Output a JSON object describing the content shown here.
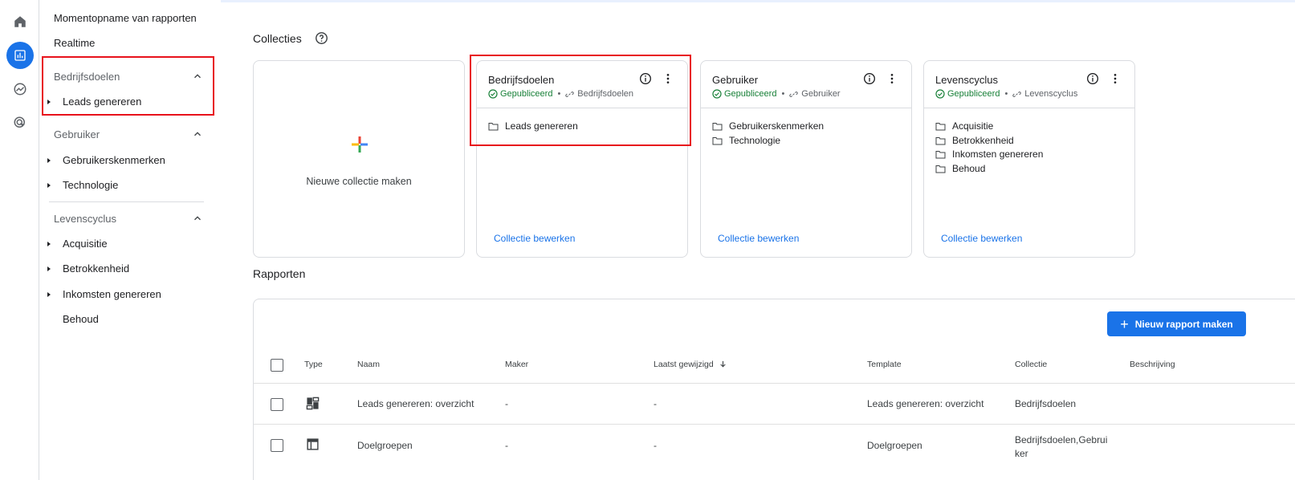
{
  "nav": {
    "snapshot": "Momentopname van rapporten",
    "realtime": "Realtime",
    "sections": [
      {
        "title": "Bedrijfsdoelen",
        "items": [
          "Leads genereren"
        ]
      },
      {
        "title": "Gebruiker",
        "items": [
          "Gebruikerskenmerken",
          "Technologie"
        ]
      },
      {
        "title": "Levenscyclus",
        "items": [
          "Acquisitie",
          "Betrokkenheid",
          "Inkomsten genereren",
          "Behoud"
        ]
      }
    ]
  },
  "collections": {
    "title": "Collecties",
    "new_card_label": "Nieuwe collectie maken",
    "cards": [
      {
        "title": "Bedrijfsdoelen",
        "status": "Gepubliceerd",
        "link": "Bedrijfsdoelen",
        "folders": [
          "Leads genereren"
        ],
        "edit": "Collectie bewerken"
      },
      {
        "title": "Gebruiker",
        "status": "Gepubliceerd",
        "link": "Gebruiker",
        "folders": [
          "Gebruikerskenmerken",
          "Technologie"
        ],
        "edit": "Collectie bewerken"
      },
      {
        "title": "Levenscyclus",
        "status": "Gepubliceerd",
        "link": "Levenscyclus",
        "folders": [
          "Acquisitie",
          "Betrokkenheid",
          "Inkomsten genereren",
          "Behoud"
        ],
        "edit": "Collectie bewerken"
      }
    ]
  },
  "reports": {
    "title": "Rapporten",
    "new_button": "Nieuw rapport maken",
    "columns": [
      "Type",
      "Naam",
      "Maker",
      "Laatst gewijzigd",
      "Template",
      "Collectie",
      "Beschrijving"
    ],
    "rows": [
      {
        "name": "Leads genereren: overzicht",
        "maker": "-",
        "modified": "-",
        "template": "Leads genereren: overzicht",
        "collection": "Bedrijfsdoelen"
      },
      {
        "name": "Doelgroepen",
        "maker": "-",
        "modified": "-",
        "template": "Doelgroepen",
        "collection_line1": "Bedrijfsdoelen,Gebrui",
        "collection_line2": "ker"
      }
    ]
  },
  "colors": {
    "accent": "#1a73e8",
    "published": "#188038",
    "highlight": "#e8121b"
  }
}
